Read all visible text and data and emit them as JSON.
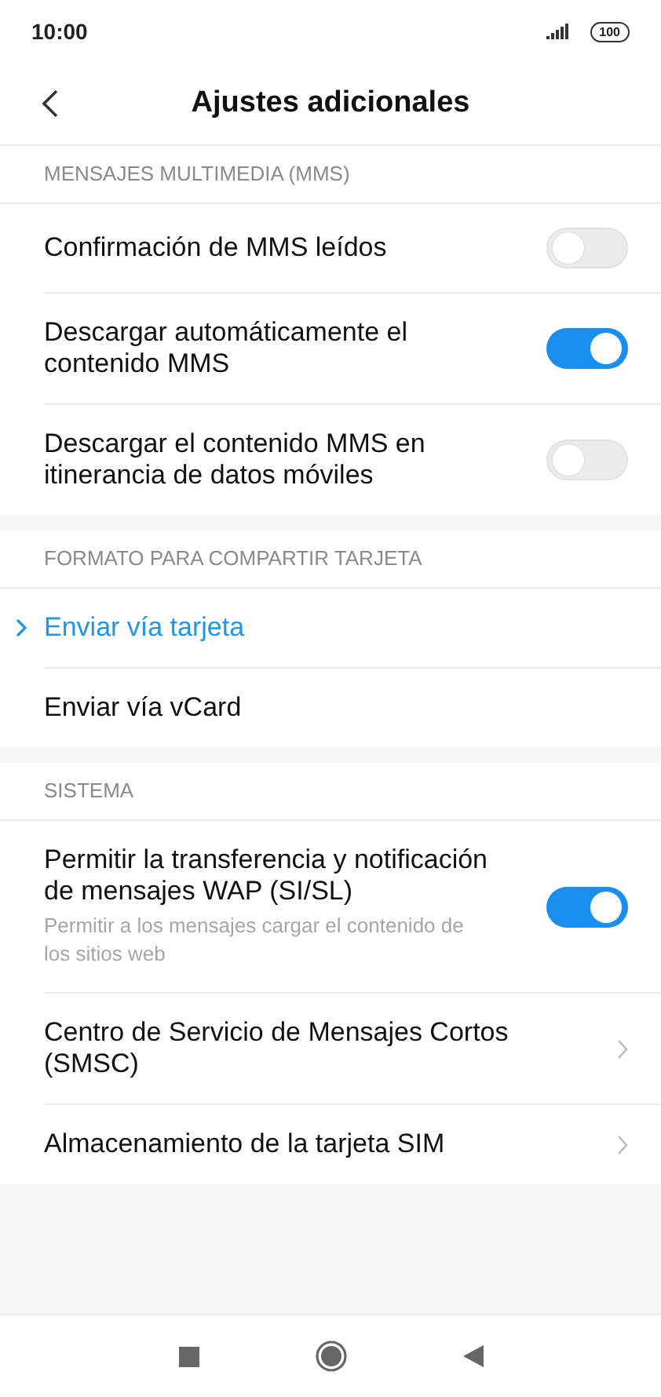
{
  "status_bar": {
    "time": "10:00",
    "battery": "100"
  },
  "header": {
    "title": "Ajustes adicionales"
  },
  "sections": [
    {
      "title": "MENSAJES MULTIMEDIA (MMS)",
      "items": [
        {
          "kind": "toggle",
          "label": "Confirmación de MMS leídos",
          "on": false
        },
        {
          "kind": "toggle",
          "label": "Descargar automáticamente el contenido MMS",
          "on": true
        },
        {
          "kind": "toggle",
          "label": "Descargar el contenido MMS en itinerancia de datos móviles",
          "on": false
        }
      ]
    },
    {
      "title": "FORMATO PARA COMPARTIR TARJETA",
      "items": [
        {
          "kind": "choice",
          "label": "Enviar vía tarjeta",
          "selected": true
        },
        {
          "kind": "choice",
          "label": "Enviar vía vCard",
          "selected": false
        }
      ]
    },
    {
      "title": "SISTEMA",
      "items": [
        {
          "kind": "toggle",
          "label": "Permitir la transferencia y notificación de mensajes WAP (SI/SL)",
          "description": "Permitir a los mensajes cargar el contenido de los sitios web",
          "on": true
        },
        {
          "kind": "link",
          "label": "Centro de Servicio de Mensajes Cortos (SMSC)"
        },
        {
          "kind": "link",
          "label": "Almacenamiento de la tarjeta SIM"
        }
      ]
    }
  ]
}
